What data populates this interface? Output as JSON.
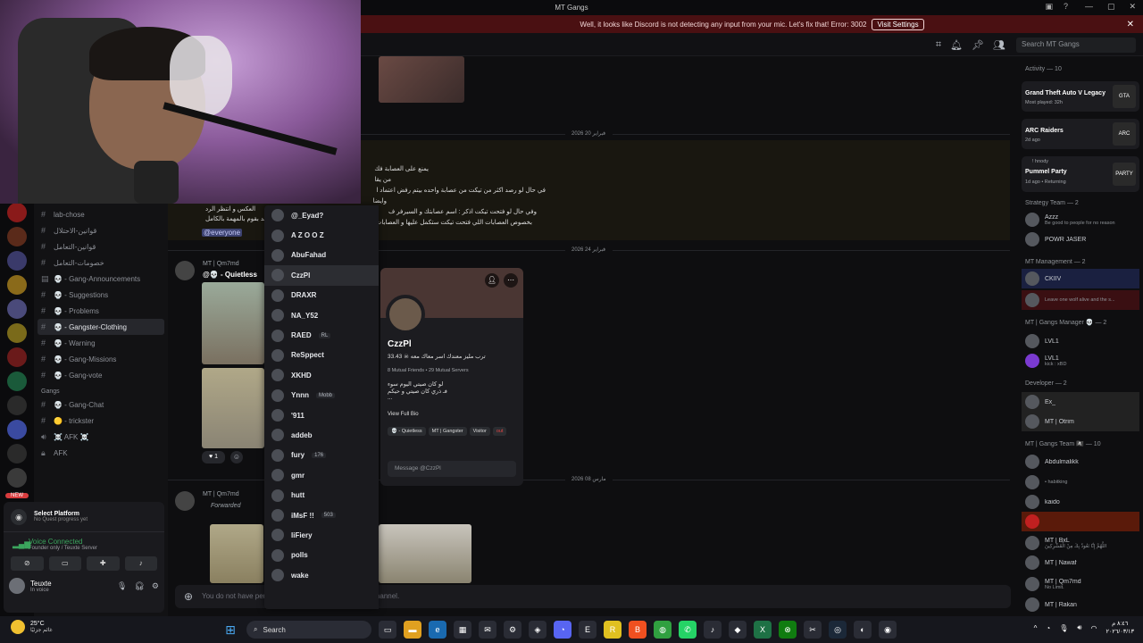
{
  "window": {
    "title": "MT Gangs"
  },
  "banner": {
    "message": "Well, it looks like Discord is not detecting any input from your mic. Let's fix that!  Error: 3002",
    "button": "Visit Settings"
  },
  "header": {
    "search_placeholder": "Search MT Gangs"
  },
  "sidebar": {
    "channels": [
      {
        "label": "lab-chose",
        "icon": "hash"
      },
      {
        "label": "قوانين-الاحتلال",
        "icon": "hash"
      },
      {
        "label": "قوانين-التعامل",
        "icon": "hash"
      },
      {
        "label": "خصومات-التعامل",
        "icon": "hash"
      },
      {
        "label": "💀 - Gang-Announcements",
        "icon": "announce"
      },
      {
        "label": "💀 - Suggestions",
        "icon": "hash"
      },
      {
        "label": "💀 - Problems",
        "icon": "hash"
      },
      {
        "label": "💀 - Gangster-Clothing",
        "icon": "hash",
        "active": true
      },
      {
        "label": "💀 - Warning",
        "icon": "hash"
      },
      {
        "label": "💀 - Gang-Missions",
        "icon": "hash"
      },
      {
        "label": "💀 - Gang-vote",
        "icon": "hash"
      }
    ],
    "category_gangs": "Gangs",
    "gang_channels": [
      {
        "label": "💀 - Gang-Chat",
        "icon": "hash"
      },
      {
        "label": "🟡 - trickster",
        "icon": "hash"
      },
      {
        "label": "☠️ AFK ☠️",
        "icon": "voice"
      },
      {
        "label": "AFK",
        "icon": "lock"
      }
    ],
    "new_badge": "NEW"
  },
  "user_panel": {
    "quest_title": "Select Platform",
    "quest_sub": "No Quest progress yet",
    "voice_status": "Voice Connected",
    "voice_server": "Founder only / Teuxte Server",
    "username": "Teuxte",
    "user_status": "In voice"
  },
  "chat": {
    "date1": "فبراير 20 2026",
    "date2": "فبراير 24 2026",
    "date3": "مارس 08 2026",
    "announcement_lines": [
      "يمنع على العصابة فك",
      "من يقا",
      "في حال لو رصد اكثر من تيكت من عصابة واحده بيتم رفض اعتماد ا",
      "وايضا",
      "وفي حال لو فتحت تيكت اذكر : اسم عصابتك و السيرفر ف",
      "بخصوص العصابات اللي فتحت تيكت ستكمل عليها و العصابات ا"
    ],
    "announce_left_1": "العكس و انتظر الرد",
    "announce_left_2": "حد بقوم بالمهمة بالكامل",
    "everyone": "@everyone",
    "msg1_user": "MT | Qm7md",
    "msg1_text": "@💀 - Quietless",
    "msg2_user": "MT | Qm7md",
    "forwarded": "Forwarded",
    "reaction_count": "1",
    "composer_placeholder": "You do not have permission to send messages in this channel."
  },
  "mentions": [
    {
      "name": "@_Eyad?",
      "tag": ""
    },
    {
      "name": "A Z O O Z",
      "tag": ""
    },
    {
      "name": "AbuFahad",
      "tag": ""
    },
    {
      "name": "CzzPl",
      "tag": "",
      "selected": true
    },
    {
      "name": "DRAXR",
      "tag": ""
    },
    {
      "name": "NA_Y52",
      "tag": ""
    },
    {
      "name": "RAED",
      "tag": "RL"
    },
    {
      "name": "ReSppect",
      "tag": ""
    },
    {
      "name": "XKHD",
      "tag": ""
    },
    {
      "name": "Ynnn",
      "tag": "Mobb"
    },
    {
      "name": "'911",
      "tag": ""
    },
    {
      "name": "addeb",
      "tag": ""
    },
    {
      "name": "fury",
      "tag": "176"
    },
    {
      "name": "gmr",
      "tag": ""
    },
    {
      "name": "hutt",
      "tag": ""
    },
    {
      "name": "iMsF !!",
      "tag": "503"
    },
    {
      "name": "liFiery",
      "tag": ""
    },
    {
      "name": "polls",
      "tag": ""
    },
    {
      "name": "wake",
      "tag": ""
    }
  ],
  "profile": {
    "name": "CzzPl",
    "subtitle": "33.43 ☠ ترب مليز معندك اسر معاك معه",
    "mutuals": "8 Mutual Friends  •  29 Mutual Servers",
    "bio_line1": "لو كان صيتي اليوم سوء",
    "bio_line2": "فـ ذري كان صيتي و حيكم",
    "bio_line3": "...",
    "view_bio": "View Full Bio",
    "roles": [
      "💀 - Quietless",
      "MT | Gangster",
      "Visitor",
      "out"
    ],
    "message_placeholder": "Message @CzzPl"
  },
  "members": {
    "activity_header": "Activity — 10",
    "activities": [
      {
        "title": "Grand Theft Auto V Legacy",
        "sub": "Most played: 32h",
        "art": "GTA"
      },
      {
        "title": "ARC Raiders",
        "sub": "2d ago",
        "art": "ARC"
      },
      {
        "title": "Pummel Party",
        "sub": "1d ago • Returning",
        "art": "PARTY",
        "pre": "! hnody"
      }
    ],
    "group1": "Strategy Team — 2",
    "g1": [
      {
        "name": "Azzz",
        "tag": "LVL1",
        "sub": "Be good to people for no reason"
      },
      {
        "name": "POWR JASER",
        "tag": "",
        "sub": ""
      }
    ],
    "group2": "MT Management — 2",
    "g2": [
      {
        "name": "CKIIV",
        "tag": "",
        "sub": ""
      },
      {
        "name": "",
        "tag": "",
        "sub": "Leave one wolf alive and the s..."
      }
    ],
    "group3": "MT | Gangs Manager 💀 — 2",
    "g3": [
      {
        "name": "LVL1",
        "tag": "",
        "sub": ""
      },
      {
        "name": "LVL1",
        "tag": "",
        "sub": "kick : xBD"
      }
    ],
    "group4": "Developer — 2",
    "g4": [
      {
        "name": "Ex_",
        "tag": "",
        "sub": ""
      },
      {
        "name": "MT | Otrim",
        "tag": "",
        "sub": ""
      }
    ],
    "group5": "MT | Gangs Team 🏴‍☠️ — 10",
    "g5": [
      {
        "name": "Abdulmalikk",
        "tag": "",
        "sub": ""
      },
      {
        "name": "",
        "tag": "",
        "sub": "• habitking"
      },
      {
        "name": "kaido",
        "tag": "",
        "sub": ""
      },
      {
        "name": "",
        "tag": "",
        "sub": ""
      },
      {
        "name": "MT | BxL",
        "tag": "",
        "sub": "اللَّهُمَّ إِنَّا نَعُوذُ بِكَ مِنْ الْمُشْرِكِينَ"
      },
      {
        "name": "MT | Nawaf",
        "tag": "",
        "sub": ""
      },
      {
        "name": "MT | Qm7md",
        "tag": "M.",
        "sub": "No Limit."
      },
      {
        "name": "",
        "tag": "",
        "sub": ""
      },
      {
        "name": "MT | Rakan",
        "tag": "MT",
        "sub": ""
      }
    ]
  },
  "taskbar": {
    "temp": "25°C",
    "weather_sub": "غائم جزئيًا",
    "search": "Search",
    "time": "٨:٤٦ م",
    "date": "٢٠٢٦/٠٣/١٣"
  },
  "colors": {
    "accent_green": "#3ba55d",
    "banner_bg": "#4a1012",
    "mention_bg": "#3c4270"
  }
}
